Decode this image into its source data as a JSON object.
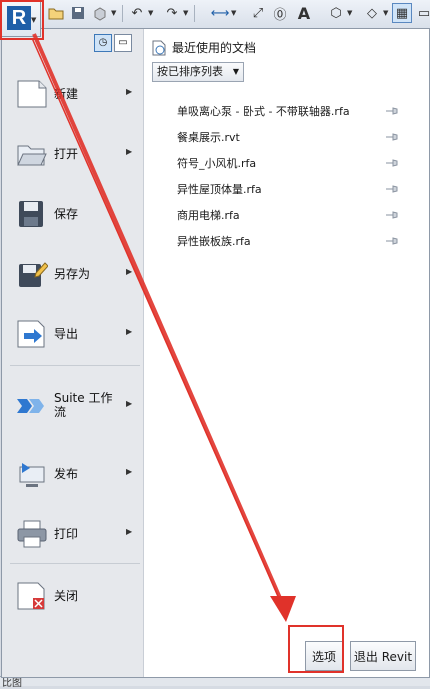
{
  "toolbar": {
    "icons": [
      "application-menu-icon",
      "open-icon",
      "save-icon",
      "sync-icon",
      "undo-icon",
      "redo-icon",
      "measure-icon",
      "dimension-icon",
      "tag-icon",
      "text-icon",
      "3d-view-icon",
      "section-icon",
      "switch-windows-icon"
    ]
  },
  "menu": {
    "items": [
      {
        "label": "新建",
        "icon": "new-document-icon",
        "submenu": true
      },
      {
        "label": "打开",
        "icon": "open-folder-icon",
        "submenu": true
      },
      {
        "label": "保存",
        "icon": "save-disk-icon",
        "submenu": false
      },
      {
        "label": "另存为",
        "icon": "save-as-icon",
        "submenu": true
      },
      {
        "label": "导出",
        "icon": "export-icon",
        "submenu": true
      },
      {
        "label": "Suite 工作流",
        "icon": "suite-workflow-icon",
        "submenu": true
      },
      {
        "label": "发布",
        "icon": "publish-icon",
        "submenu": true
      },
      {
        "label": "打印",
        "icon": "print-icon",
        "submenu": true
      },
      {
        "label": "关闭",
        "icon": "close-document-icon",
        "submenu": false
      }
    ]
  },
  "recent": {
    "title": "最近使用的文档",
    "sort_label": "按已排序列表",
    "documents": [
      "单吸离心泵 - 卧式 - 不带联轴器.rfa",
      "餐桌展示.rvt",
      "符号_小风机.rfa",
      "异性屋顶体量.rfa",
      "商用电梯.rfa",
      "异性嵌板族.rfa"
    ]
  },
  "buttons": {
    "options": "选项",
    "exit": "退出 Revit"
  },
  "status": {
    "text": "比图"
  },
  "colors": {
    "annotation": "#e0322a",
    "menu_bg": "#e6e8ec",
    "accent": "#1f5fa8"
  }
}
